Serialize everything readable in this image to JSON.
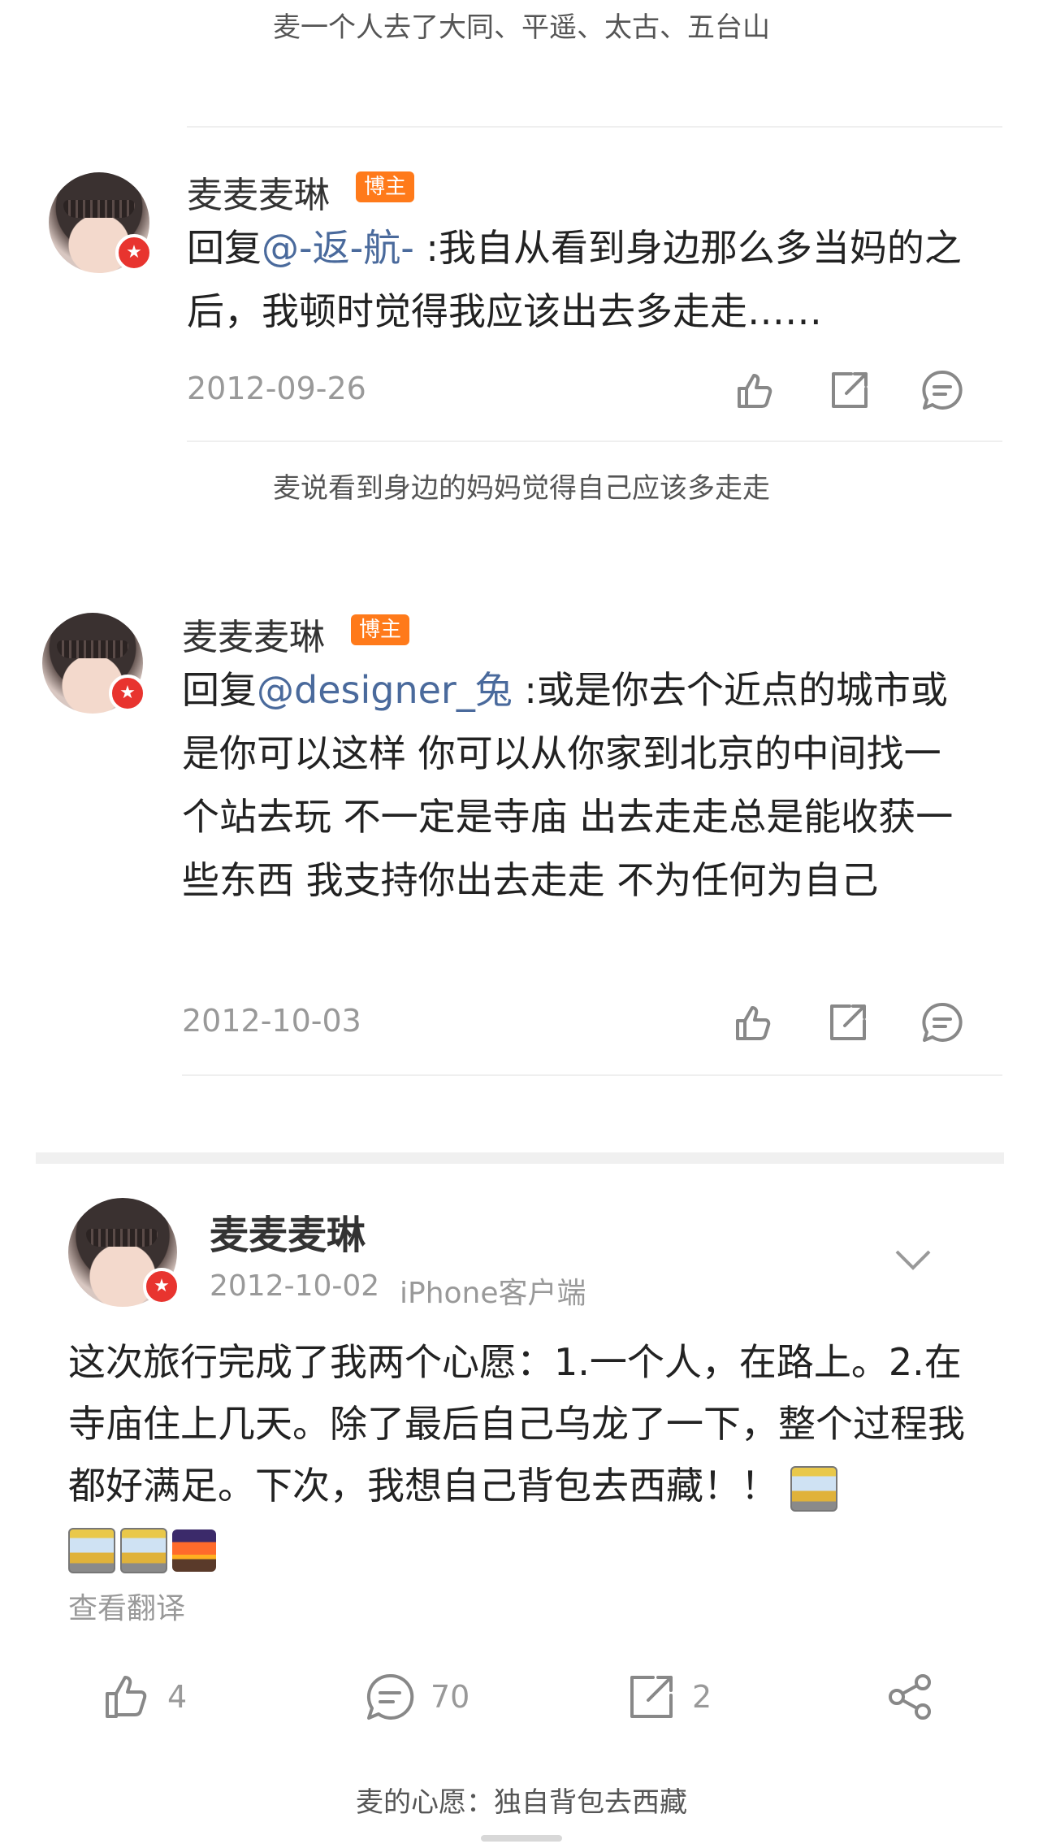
{
  "captions": {
    "top": "麦一个人去了大同、平遥、太古、五台山",
    "middle": "麦说看到身边的妈妈觉得自己应该多走走",
    "bottom": "麦的心愿：独自背包去西藏"
  },
  "replies": [
    {
      "username": "麦麦麦琳",
      "tag": "博主",
      "prefix": "回复",
      "mention": "@-返-航-",
      "text": " :我自从看到身边那么多当妈的之后，我顿时觉得我应该出去多走走……",
      "date": "2012-09-26"
    },
    {
      "username": "麦麦麦琳",
      "tag": "博主",
      "prefix": "回复",
      "mention": "@designer_兔",
      "text": " :或是你去个近点的城市或是你可以这样 你可以从你家到北京的中间找一个站去玩 不一定是寺庙 出去走走总是能收获一些东西 我支持你出去走走 不为任何为自己",
      "date": "2012-10-03"
    }
  ],
  "post": {
    "username": "麦麦麦琳",
    "date": "2012-10-02",
    "source": "iPhone客户端",
    "text": "这次旅行完成了我两个心愿：1.一个人，在路上。2.在寺庙住上几天。除了最后自己乌龙了一下，整个过程我都好满足。下次，我想自己背包去西藏！！",
    "emojis": [
      "train-emoji",
      "train-emoji",
      "train-emoji",
      "sunrise-emoji"
    ],
    "translate_label": "查看翻译",
    "likes": "4",
    "comments": "70",
    "reposts": "2"
  },
  "icons": {
    "like": "thumbs-up-icon",
    "repost": "share-out-icon",
    "comment": "comment-bubble-icon",
    "share": "share-nodes-icon",
    "more": "chevron-down-icon"
  },
  "colors": {
    "mention": "#4a6a9c",
    "tag_bg": "#ff7a1a",
    "badge": "#e8342f"
  }
}
